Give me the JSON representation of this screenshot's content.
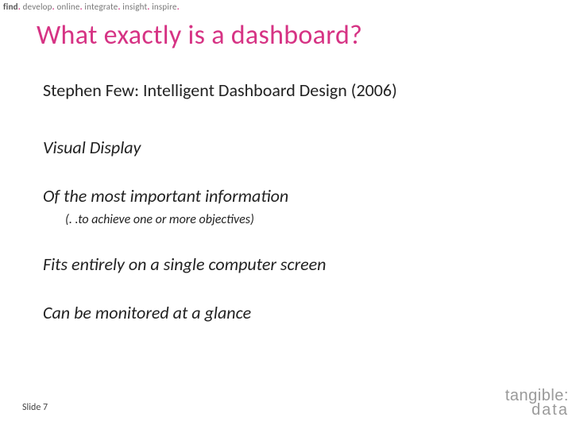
{
  "tagline": {
    "w1": "find",
    "w2": "develop",
    "w3": "online",
    "w4": "integrate",
    "w5": "insight",
    "w6": "inspire"
  },
  "title": "What exactly is a dashboard?",
  "lines": {
    "author": "Stephen Few: Intelligent Dashboard Design (2006)",
    "visual": "Visual Display",
    "important": "Of the most important information",
    "subnote": "(. .to achieve one or more objectives)",
    "fits": "Fits entirely on a single computer screen",
    "glance": "Can be monitored at a glance"
  },
  "footer": {
    "slide_label": "Slide 7"
  },
  "logo": {
    "line1": "tangible:",
    "line2": "data"
  }
}
